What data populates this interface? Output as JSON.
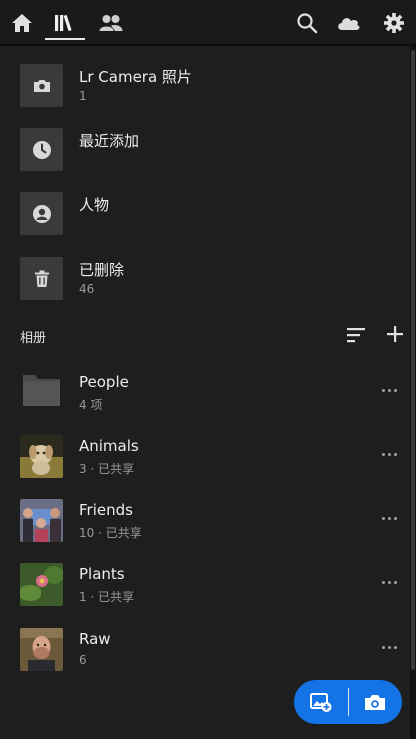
{
  "topbar": {
    "left_icons": [
      "home-icon",
      "library-icon",
      "people-icon"
    ],
    "right_icons": [
      "search-icon",
      "cloud-icon",
      "gear-icon"
    ]
  },
  "library": [
    {
      "title": "Lr Camera 照片",
      "sub": "1",
      "icon": "camera-icon"
    },
    {
      "title": "最近添加",
      "sub": "",
      "icon": "clock-icon"
    },
    {
      "title": "人物",
      "sub": "",
      "icon": "person-icon"
    },
    {
      "title": "已删除",
      "sub": "46",
      "icon": "trash-icon"
    }
  ],
  "albums_section": {
    "label": "相册"
  },
  "albums": [
    {
      "title": "People",
      "sub": "4 项"
    },
    {
      "title": "Animals",
      "sub": "3 · 已共享"
    },
    {
      "title": "Friends",
      "sub": "10 · 已共享"
    },
    {
      "title": "Plants",
      "sub": "1 · 已共享"
    },
    {
      "title": "Raw",
      "sub": "6"
    }
  ],
  "fab": {
    "left_icon": "add-photo-icon",
    "right_icon": "camera-icon"
  },
  "colors": {
    "background": "#1e1e1e",
    "accent": "#1473e6",
    "tile": "#3a3a3a"
  }
}
